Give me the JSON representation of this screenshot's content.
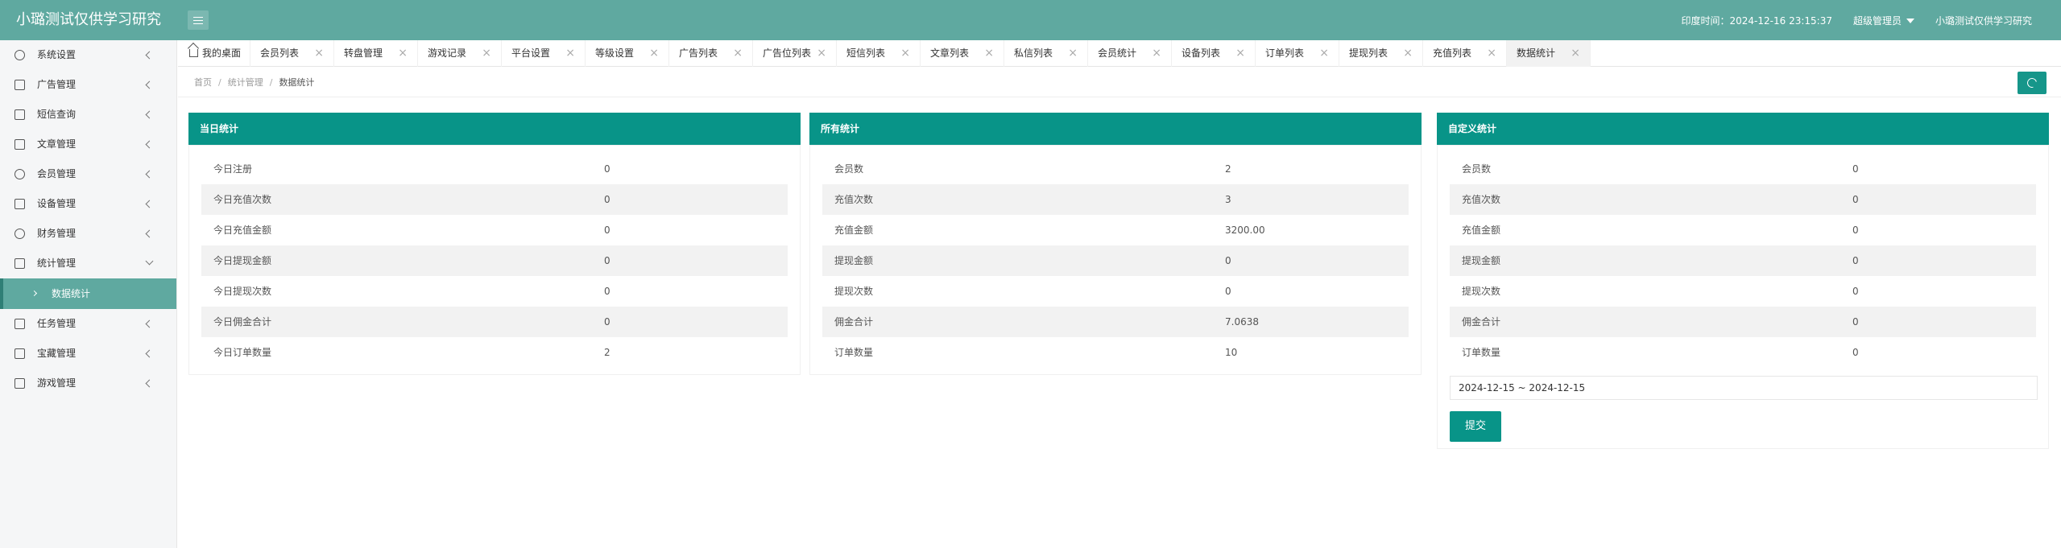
{
  "header": {
    "title": "小璐测试仅供学习研究",
    "time_text": "印度时间：2024-12-16 23:15:37",
    "user_menu": "超级管理员",
    "site_name": "小璐测试仅供学习研究"
  },
  "sidebar": {
    "items": [
      {
        "label": "系统设置",
        "icon": "gear-icon"
      },
      {
        "label": "广告管理",
        "icon": "image-icon"
      },
      {
        "label": "短信查询",
        "icon": "mail-icon"
      },
      {
        "label": "文章管理",
        "icon": "book-icon"
      },
      {
        "label": "会员管理",
        "icon": "user-icon"
      },
      {
        "label": "设备管理",
        "icon": "shuffle-icon"
      },
      {
        "label": "财务管理",
        "icon": "dollar-icon"
      },
      {
        "label": "统计管理",
        "icon": "pulse-icon"
      }
    ],
    "active_sub": "数据统计",
    "items_after": [
      {
        "label": "任务管理",
        "icon": "sliders-icon"
      },
      {
        "label": "宝藏管理",
        "icon": "box-icon"
      },
      {
        "label": "游戏管理",
        "icon": "box-icon"
      }
    ]
  },
  "tabs": [
    "我的桌面",
    "会员列表",
    "转盘管理",
    "游戏记录",
    "平台设置",
    "等级设置",
    "广告列表",
    "广告位列表",
    "短信列表",
    "文章列表",
    "私信列表",
    "会员统计",
    "设备列表",
    "订单列表",
    "提现列表",
    "充值列表",
    "数据统计"
  ],
  "breadcrumb": {
    "home": "首页",
    "section": "统计管理",
    "current": "数据统计"
  },
  "panels": {
    "today": {
      "title": "当日统计",
      "rows": [
        {
          "label": "今日注册",
          "value": "0"
        },
        {
          "label": "今日充值次数",
          "value": "0"
        },
        {
          "label": "今日充值金额",
          "value": "0"
        },
        {
          "label": "今日提现金额",
          "value": "0"
        },
        {
          "label": "今日提现次数",
          "value": "0"
        },
        {
          "label": "今日佣金合计",
          "value": "0"
        },
        {
          "label": "今日订单数量",
          "value": "2"
        }
      ]
    },
    "all": {
      "title": "所有统计",
      "rows": [
        {
          "label": "会员数",
          "value": "2"
        },
        {
          "label": "充值次数",
          "value": "3"
        },
        {
          "label": "充值金额",
          "value": "3200.00"
        },
        {
          "label": "提现金额",
          "value": "0"
        },
        {
          "label": "提现次数",
          "value": "0"
        },
        {
          "label": "佣金合计",
          "value": "7.0638"
        },
        {
          "label": "订单数量",
          "value": "10"
        }
      ]
    },
    "custom": {
      "title": "自定义统计",
      "rows": [
        {
          "label": "会员数",
          "value": "0"
        },
        {
          "label": "充值次数",
          "value": "0"
        },
        {
          "label": "充值金额",
          "value": "0"
        },
        {
          "label": "提现金额",
          "value": "0"
        },
        {
          "label": "提现次数",
          "value": "0"
        },
        {
          "label": "佣金合计",
          "value": "0"
        },
        {
          "label": "订单数量",
          "value": "0"
        }
      ],
      "date_range": "2024-12-15 ~ 2024-12-15",
      "submit_label": "提交"
    }
  },
  "colors": {
    "header_bg": "#5fa9a0",
    "primary": "#089488",
    "row_alt": "#f2f2f2"
  }
}
